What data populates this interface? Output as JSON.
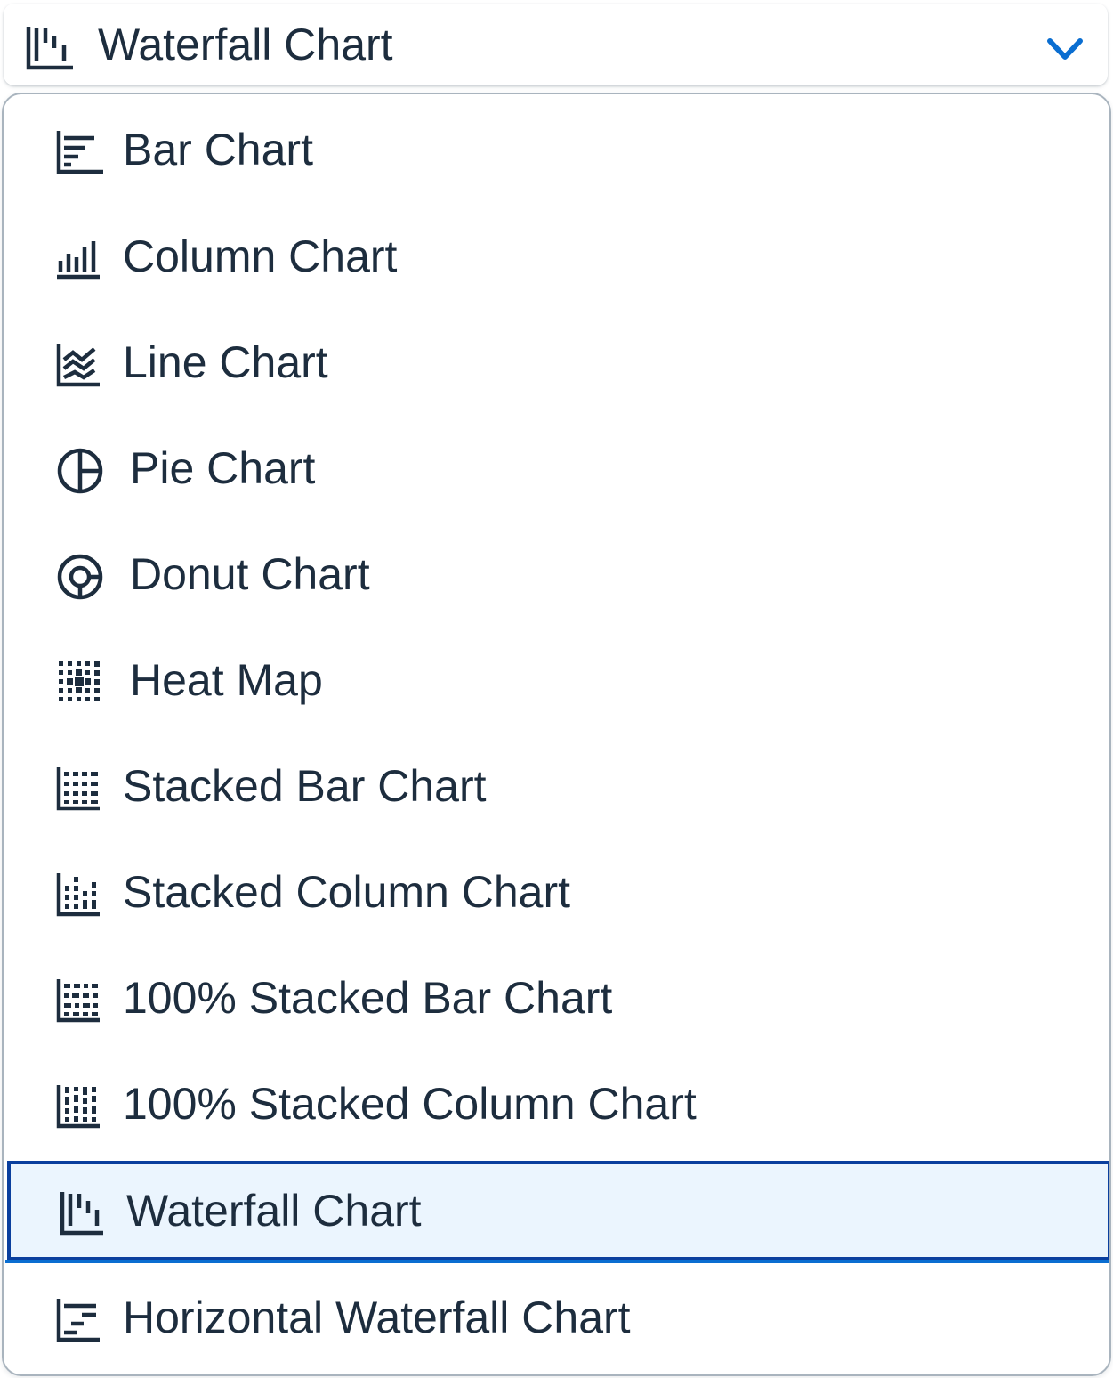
{
  "select": {
    "value": "Waterfall Chart",
    "icon": "waterfall-chart-icon",
    "expand_icon": "chevron-down-icon"
  },
  "options": [
    {
      "label": "Bar Chart",
      "icon": "bar-chart-icon",
      "selected": false
    },
    {
      "label": "Column Chart",
      "icon": "column-chart-icon",
      "selected": false
    },
    {
      "label": "Line Chart",
      "icon": "line-chart-icon",
      "selected": false
    },
    {
      "label": "Pie Chart",
      "icon": "pie-chart-icon",
      "selected": false
    },
    {
      "label": "Donut Chart",
      "icon": "donut-chart-icon",
      "selected": false
    },
    {
      "label": "Heat Map",
      "icon": "heat-map-icon",
      "selected": false
    },
    {
      "label": "Stacked Bar Chart",
      "icon": "stacked-bar-chart-icon",
      "selected": false
    },
    {
      "label": "Stacked Column Chart",
      "icon": "stacked-column-chart-icon",
      "selected": false
    },
    {
      "label": "100% Stacked Bar Chart",
      "icon": "full-stacked-bar-chart-icon",
      "selected": false
    },
    {
      "label": "100% Stacked Column Chart",
      "icon": "full-stacked-column-chart-icon",
      "selected": false
    },
    {
      "label": "Waterfall Chart",
      "icon": "waterfall-chart-icon",
      "selected": true
    },
    {
      "label": "Horizontal Waterfall Chart",
      "icon": "horizontal-waterfall-chart-icon",
      "selected": false
    }
  ],
  "colors": {
    "text": "#1d2d3e",
    "accent": "#0a6ed1",
    "selected_border": "#0a3f9e",
    "selected_background": "#ebf5fe",
    "border": "#a9b4be"
  }
}
